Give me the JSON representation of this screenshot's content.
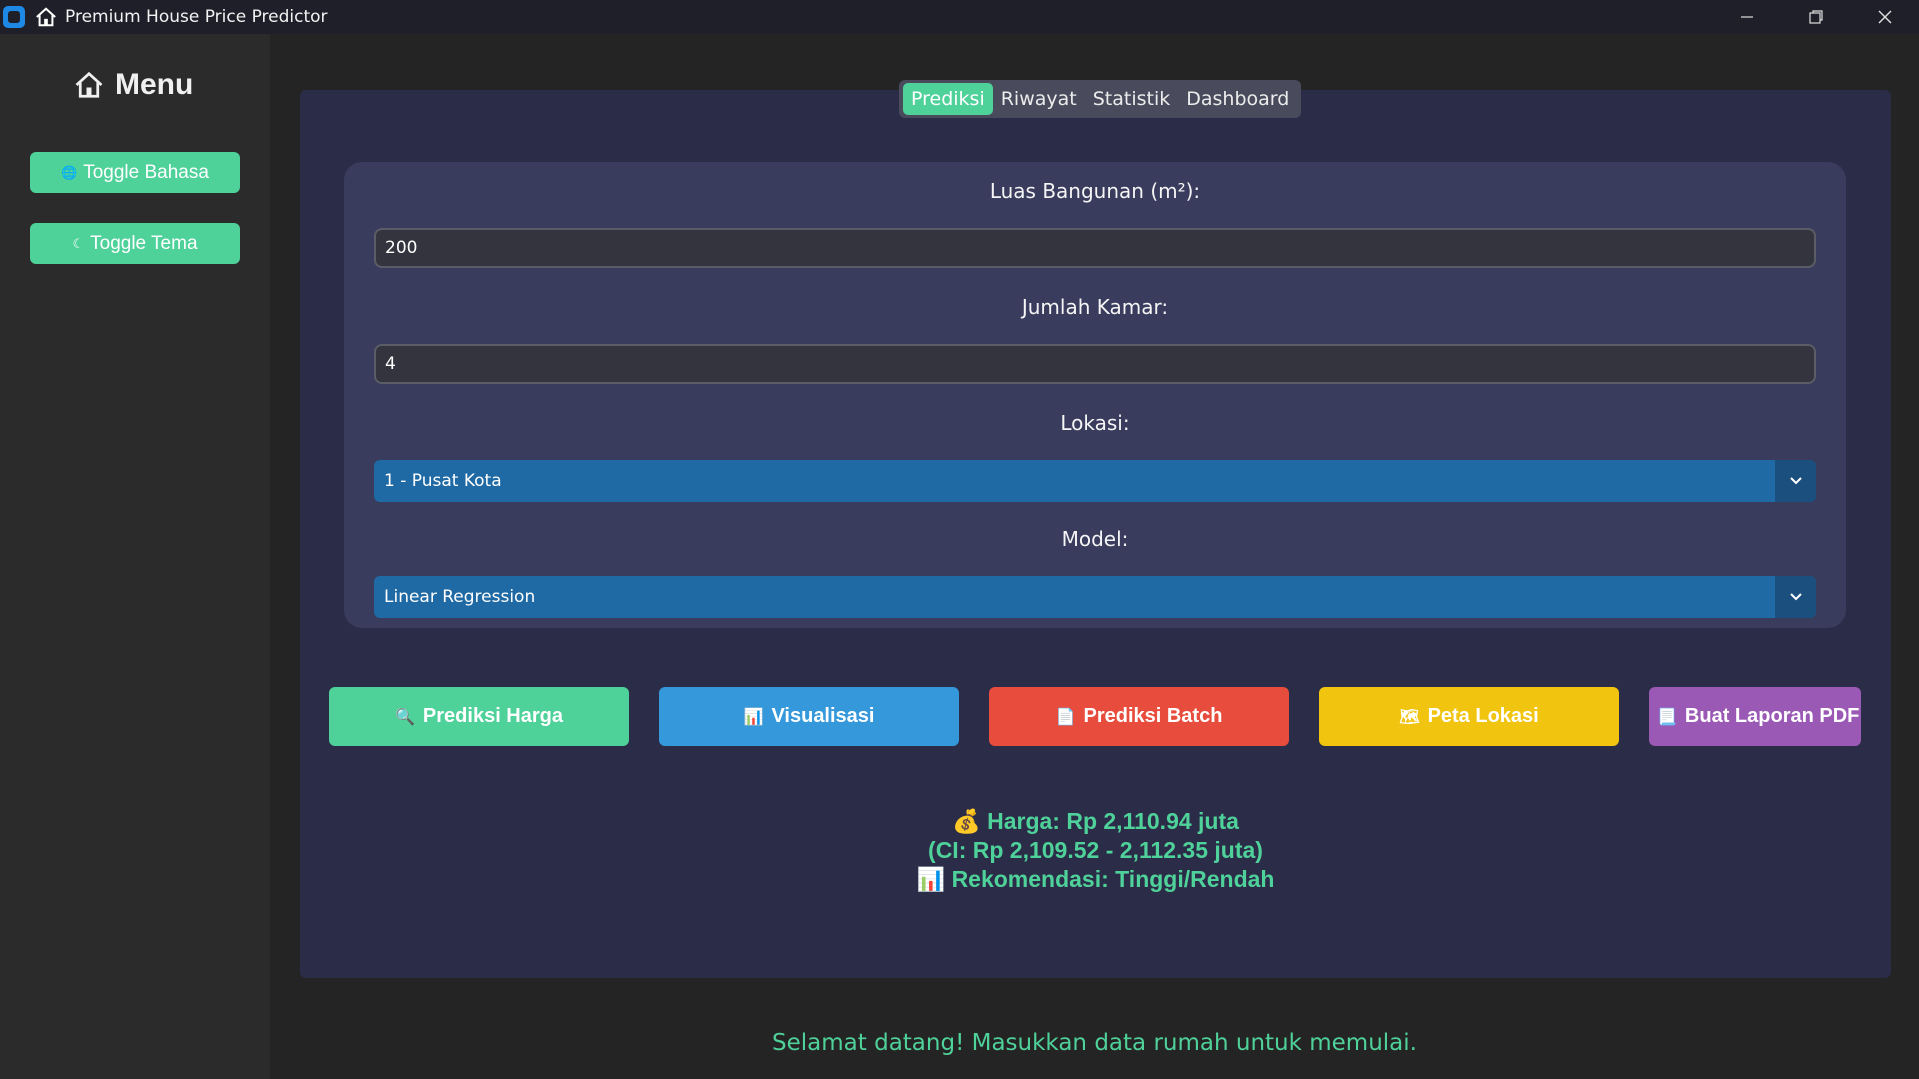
{
  "window": {
    "title": "Premium House Price Predictor",
    "app_icon": "app-icon",
    "title_icon": "house-icon",
    "controls": [
      "minimize-icon",
      "restore-icon",
      "close-icon"
    ]
  },
  "sidebar": {
    "title": "Menu",
    "title_icon": "house-icon",
    "buttons": [
      {
        "label": "Toggle Bahasa",
        "icon": "globe-icon",
        "glyph": "🌐"
      },
      {
        "label": "Toggle Tema",
        "icon": "moon-icon",
        "glyph": "☾"
      }
    ]
  },
  "tabs": [
    {
      "label": "Prediksi",
      "active": true
    },
    {
      "label": "Riwayat",
      "active": false
    },
    {
      "label": "Statistik",
      "active": false
    },
    {
      "label": "Dashboard",
      "active": false
    }
  ],
  "form": {
    "area_label": "Luas Bangunan (m²):",
    "area_value": "200",
    "rooms_label": "Jumlah Kamar:",
    "rooms_value": "4",
    "location_label": "Lokasi:",
    "location_value": "1 - Pusat Kota",
    "model_label": "Model:",
    "model_value": "Linear Regression"
  },
  "actions": [
    {
      "label": "Prediksi Harga",
      "icon": "magnifier-icon",
      "glyph": "🔍",
      "color": "#4fd19a"
    },
    {
      "label": "Visualisasi",
      "icon": "chart-icon",
      "glyph": "📊",
      "color": "#3498db"
    },
    {
      "label": "Prediksi Batch",
      "icon": "document-icon",
      "glyph": "📄",
      "color": "#e74c3c"
    },
    {
      "label": "Peta Lokasi",
      "icon": "map-icon",
      "glyph": "🗺",
      "color": "#f1c40f"
    },
    {
      "label": "Buat Laporan PDF",
      "icon": "file-icon",
      "glyph": "📃",
      "color": "#9b59b6"
    }
  ],
  "result": {
    "price_icon": "money-bag-icon",
    "price_text": "Harga: Rp 2,110.94 juta",
    "ci_text": "(CI: Rp 2,109.52 - 2,112.35 juta)",
    "recommendation_icon": "chart-icon",
    "recommendation_text": "Rekomendasi: Tinggi/Rendah"
  },
  "status": "Selamat datang! Masukkan data rumah untuk memulai.",
  "colors": {
    "accent": "#4fd19a",
    "card_bg": "#2b2c48",
    "form_bg": "#3a3c5e",
    "select_bg": "#1f6aa5"
  }
}
